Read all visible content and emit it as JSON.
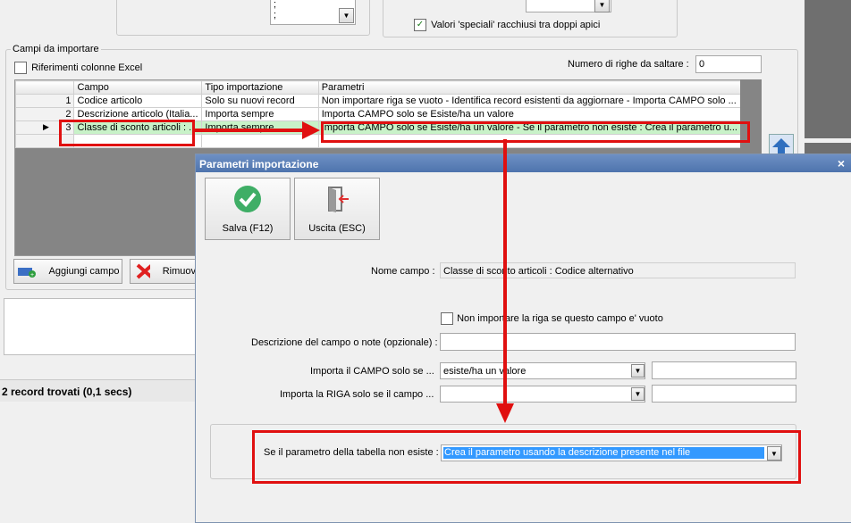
{
  "top": {
    "semicolon_1": ";",
    "semicolon_2": ";",
    "special_values_label": "Valori 'speciali' racchiusi tra doppi apici"
  },
  "fields_panel": {
    "title": "Campi da importare",
    "excel_refs_label": "Riferimenti colonne Excel",
    "skip_rows_label": "Numero di righe da saltare  :",
    "skip_rows_value": "0"
  },
  "grid": {
    "columns": [
      "Campo",
      "Tipo importazione",
      "Parametri"
    ],
    "rows": [
      {
        "num": "1",
        "campo": "Codice articolo",
        "tipo": "Solo su nuovi record",
        "parametri": "Non importare riga se vuoto - Identifica record esistenti da aggiornare - Importa CAMPO solo ..."
      },
      {
        "num": "2",
        "campo": "Descrizione articolo (Italia...",
        "tipo": "Importa sempre",
        "parametri": "Importa CAMPO solo se Esiste/ha un valore"
      },
      {
        "num": "3",
        "campo": "Classe di sconto articoli : ...",
        "tipo": "Importa sempre",
        "parametri": "Importa CAMPO solo se Esiste/ha un valore  - Se il parametro non esiste : Crea il parametro u..."
      }
    ]
  },
  "buttons": {
    "add_field": "Aggiungi campo",
    "remove": "Rimuov"
  },
  "status": {
    "records": "2 record trovati (0,1 secs)"
  },
  "dialog": {
    "title": "Parametri importazione",
    "close": "×",
    "save_label": "Salva (F12)",
    "exit_label": "Uscita (ESC)",
    "field_name_label": "Nome campo :",
    "field_name_value": "Classe di sconto articoli : Codice alternativo",
    "skip_if_empty_label": "Non importare la riga se questo campo e' vuoto",
    "description_label": "Descrizione del campo o note (opzionale) :",
    "description_value": "",
    "import_field_if_label": "Importa il CAMPO solo se ...",
    "import_field_if_value": "esiste/ha un valore",
    "import_row_if_label": "Importa la RIGA solo se il campo ...",
    "import_row_if_value": "",
    "param_missing_label": "Se il parametro della tabella non esiste :",
    "param_missing_value": "Crea il parametro usando la descrizione presente nel file"
  },
  "colors": {
    "highlight_red": "#e01010",
    "selected_row": "#c8f2c8",
    "dialog_title": "#4e74ad",
    "selected_text_bg": "#3399ff"
  },
  "icons": {
    "save": "check-circle-icon",
    "exit": "door-exit-icon",
    "add": "add-field-icon",
    "remove": "red-x-icon"
  }
}
